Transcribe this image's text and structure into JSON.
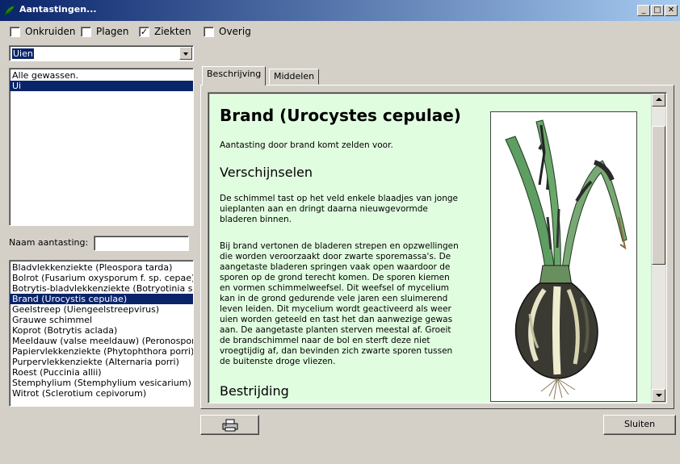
{
  "window": {
    "title": "Aantastingen..."
  },
  "filters": [
    {
      "label": "Onkruiden",
      "checked": false
    },
    {
      "label": "Plagen",
      "checked": false
    },
    {
      "label": "Ziekten",
      "checked": true
    },
    {
      "label": "Overig",
      "checked": false
    }
  ],
  "crop_select": {
    "value": "Uien"
  },
  "crops": {
    "items": [
      "Alle gewassen.",
      "Ui"
    ],
    "selected": "Ui"
  },
  "name_search": {
    "label": "Naam aantasting:",
    "value": ""
  },
  "diseases": {
    "items": [
      "Bladvlekkenziekte  (Pleospora tarda)",
      "Bolrot  (Fusarium oxysporum f. sp. cepae)",
      "Botrytis-bladvlekkenziekte  (Botryotinia squamosa)",
      "Brand  (Urocystis cepulae)",
      "Geelstreep  (Uiengeelstreepvirus)",
      "Grauwe schimmel",
      "Koprot  (Botrytis aclada)",
      "Meeldauw (valse meeldauw)  (Peronospora destructor)",
      "Papiervlekkenziekte  (Phytophthora porri)",
      "Purpervlekkenziekte  (Alternaria porri)",
      "Roest  (Puccinia allii)",
      "Stemphylium  (Stemphylium vesicarium)",
      "Witrot  (Sclerotium cepivorum)"
    ],
    "selected": "Brand  (Urocystis cepulae)"
  },
  "tabs": [
    {
      "label": "Beschrijving",
      "active": true
    },
    {
      "label": "Middelen",
      "active": false
    }
  ],
  "article": {
    "title": "Brand (Urocystes cepulae)",
    "intro": "Aantasting door brand komt zelden voor.",
    "section1_heading": "Verschijnselen",
    "section1_p1": "De schimmel tast op het veld enkele blaadjes van jonge\nuieplanten aan en dringt daarna nieuwgevormde\nbladeren binnen.",
    "section1_p2": "Bij brand vertonen de bladeren strepen en opzwellingen\ndie worden veroorzaakt door zwarte sporemassa's. De\naangetaste bladeren springen vaak open waardoor de\nsporen op de grond terecht komen. De sporen kiemen\nen vormen schimmelweefsel. Dit weefsel of mycelium\nkan in de grond gedurende vele jaren een sluimerend\nleven leiden. Dit mycelium wordt geactiveerd als weer\nuien worden geteeld en tast het dan aanwezige gewas\naan. De aangetaste planten sterven meestal af. Groeit\nde brandschimmel naar de bol en sterft deze niet\nvroegtijdig af, dan bevinden zich zwarte sporen tussen\nde buitenste droge vliezen.",
    "section2_heading": "Bestrijding",
    "content_bg": "#e0fde0"
  },
  "buttons": {
    "print_icon": "printer-icon",
    "close": "Sluiten"
  },
  "colors": {
    "selection": "#0a246a",
    "title_gradient_start": "#0a246a",
    "title_gradient_end": "#a6caf0"
  }
}
